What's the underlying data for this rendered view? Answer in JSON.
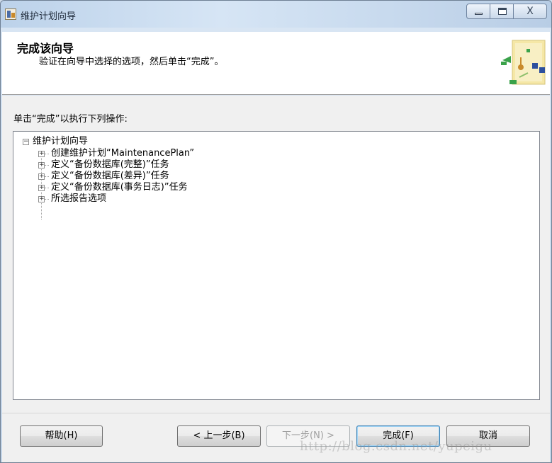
{
  "window": {
    "title": "维护计划向导",
    "close_glyph": "X"
  },
  "header": {
    "title": "完成该向导",
    "subtitle": "验证在向导中选择的选项，然后单击“完成”。",
    "graphic_icon": "wizard-graphic-icon"
  },
  "body": {
    "instruction": "单击“完成”以执行下列操作:",
    "tree": {
      "root": {
        "label": "维护计划向导",
        "expander": "−"
      },
      "children": [
        {
          "label": "创建维护计划“MaintenancePlan”",
          "expander": "+"
        },
        {
          "label": "定义“备份数据库(完整)”任务",
          "expander": "+"
        },
        {
          "label": "定义“备份数据库(差异)”任务",
          "expander": "+"
        },
        {
          "label": "定义“备份数据库(事务日志)”任务",
          "expander": "+"
        },
        {
          "label": "所选报告选项",
          "expander": "+"
        }
      ]
    }
  },
  "footer": {
    "help": "帮助(H)",
    "back": "< 上一步(B)",
    "next": "下一步(N) >",
    "finish": "完成(F)",
    "cancel": "取消",
    "watermark": "http://blog.csdn.net/yupeigu"
  },
  "colors": {
    "titlebar": "#c8daee",
    "accent_border": "#3c7fb1"
  }
}
